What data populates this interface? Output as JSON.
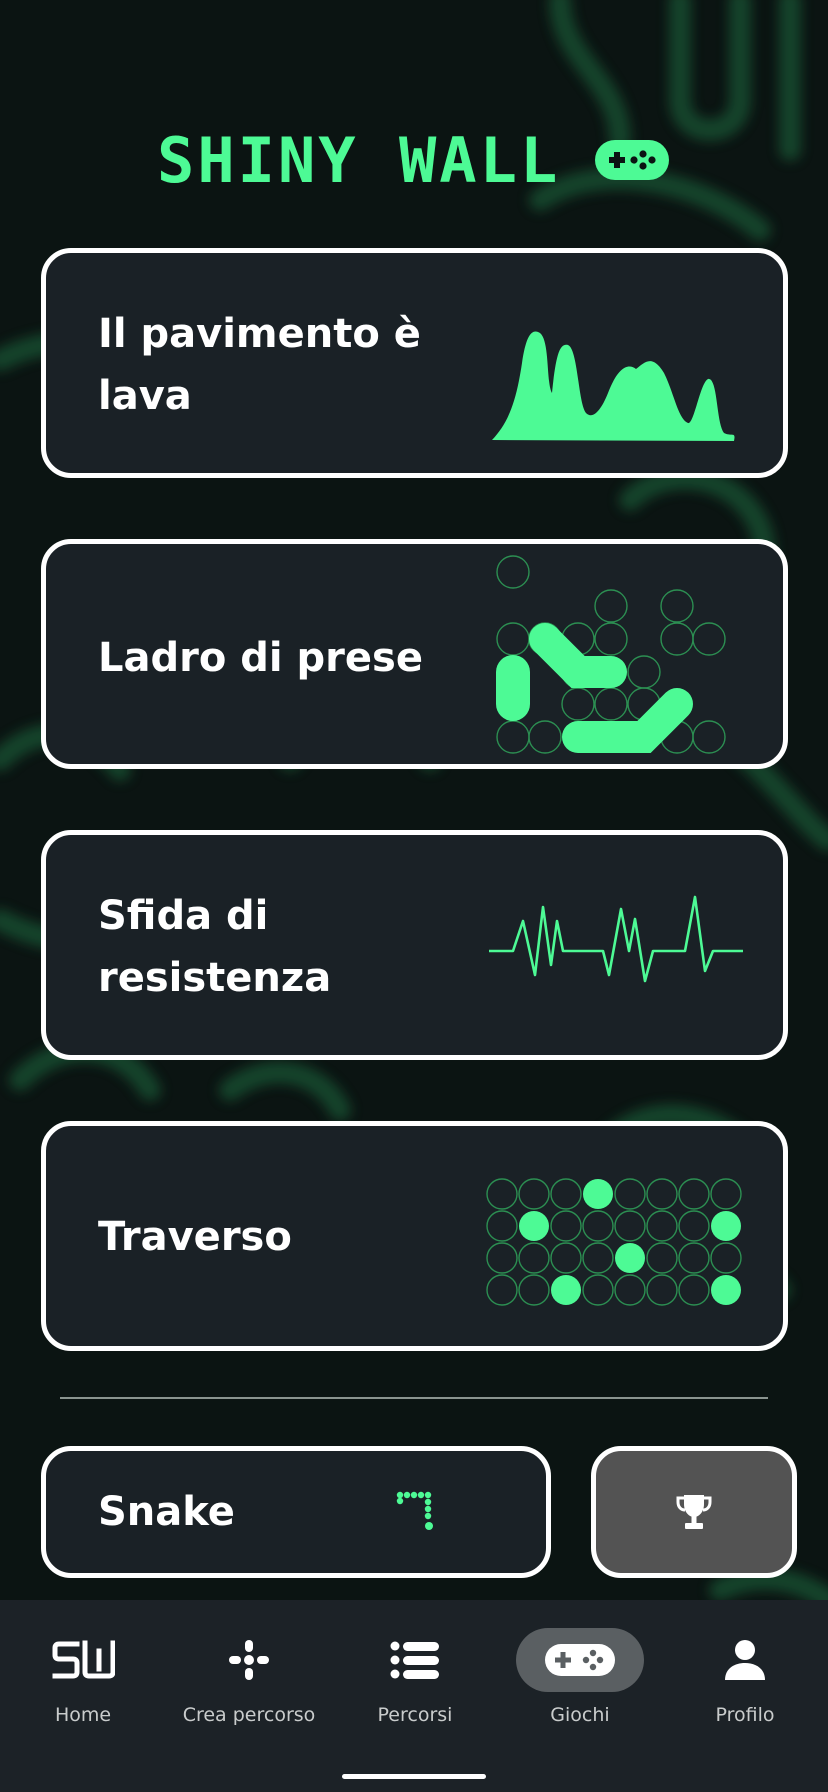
{
  "app": {
    "logo_text": "SHINY WALL"
  },
  "games": [
    {
      "title": "Il pavimento è lava",
      "art": "lava-wave-icon"
    },
    {
      "title": "Ladro di prese",
      "art": "path-grid-icon"
    },
    {
      "title": "Sfida di resistenza",
      "art": "heartbeat-icon"
    },
    {
      "title": "Traverso",
      "art": "dot-grid-icon"
    }
  ],
  "snake": {
    "title": "Snake",
    "art": "snake-icon"
  },
  "leaderboard": {
    "icon": "trophy-icon"
  },
  "nav": {
    "items": [
      {
        "label": "Home",
        "icon": "sw-logo-icon",
        "active": false
      },
      {
        "label": "Crea percorso",
        "icon": "move-icon",
        "active": false
      },
      {
        "label": "Percorsi",
        "icon": "list-icon",
        "active": false
      },
      {
        "label": "Giochi",
        "icon": "gamepad-icon",
        "active": true
      },
      {
        "label": "Profilo",
        "icon": "user-icon",
        "active": false
      }
    ]
  },
  "colors": {
    "accent": "#4dfa95",
    "card_bg": "#1a2126",
    "background": "#0b1412",
    "nav_bg": "#1c2227",
    "trophy_bg": "#535353"
  }
}
